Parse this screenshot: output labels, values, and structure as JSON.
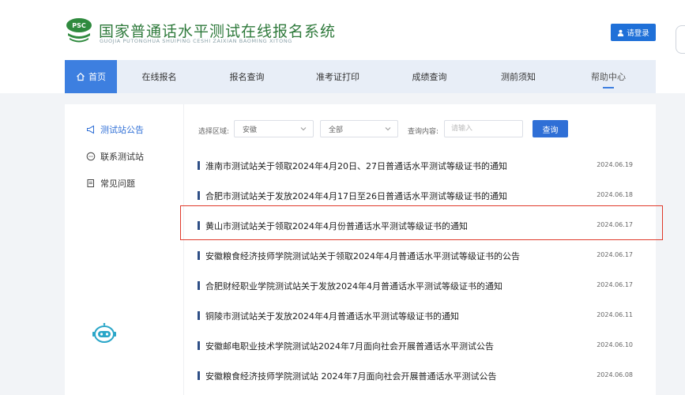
{
  "header": {
    "logo_text": "PSC",
    "title": "国家普通话水平测试在线报名系统",
    "subtitle": "GUOJIA PUTONGHUA SHUIPING CESHI ZAIXIAN BAOMING XITONG",
    "login_label": "请登录"
  },
  "nav": {
    "home": "首页",
    "items": [
      "在线报名",
      "报名查询",
      "准考证打印",
      "成绩查询",
      "测前须知",
      "帮助中心"
    ]
  },
  "sidebar": {
    "items": [
      {
        "label": "测试站公告",
        "icon": "megaphone-icon",
        "active": true
      },
      {
        "label": "联系测试站",
        "icon": "chat-icon",
        "active": false
      },
      {
        "label": "常见问题",
        "icon": "document-icon",
        "active": false
      }
    ]
  },
  "filters": {
    "region_label": "选择区域:",
    "province_value": "安徽",
    "city_value": "全部",
    "query_label": "查询内容:",
    "query_placeholder": "请输入",
    "query_button": "查询"
  },
  "announcements": [
    {
      "title": "淮南市测试站关于领取2024年4月20日、27日普通话水平测试等级证书的通知",
      "date": "2024.06.19"
    },
    {
      "title": "合肥市测试站关于发放2024年4月17日至26日普通话水平测试等级证书的通知",
      "date": "2024.06.18"
    },
    {
      "title": "黄山市测试站关于领取2024年4月份普通话水平测试等级证书的通知",
      "date": "2024.06.17"
    },
    {
      "title": "安徽粮食经济技师学院测试站关于领取2024年4月普通话水平测试等级证书的公告",
      "date": "2024.06.17"
    },
    {
      "title": "合肥财经职业学院测试站关于发放2024年4月普通话水平测试等级证书的通知",
      "date": "2024.06.17"
    },
    {
      "title": "铜陵市测试站关于发放2024年4月普通话水平测试等级证书的通知",
      "date": "2024.06.11"
    },
    {
      "title": "安徽邮电职业技术学院测试站2024年7月面向社会开展普通话水平测试公告",
      "date": "2024.06.10"
    },
    {
      "title": "安徽粮食经济技师学院测试站 2024年7月面向社会开展普通话水平测试公告",
      "date": "2024.06.08"
    }
  ],
  "colors": {
    "primary": "#2f6fd6",
    "logo_green": "#2f7a3c",
    "highlight": "#e0392a"
  }
}
